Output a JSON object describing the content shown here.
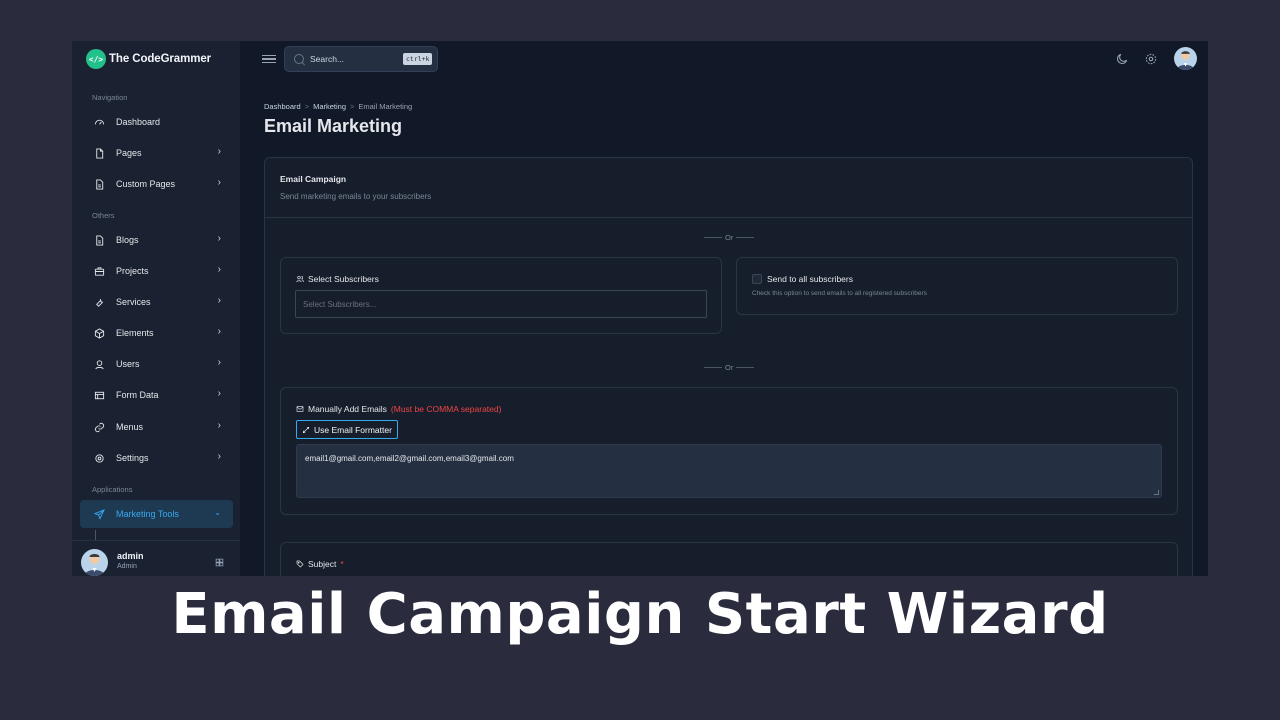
{
  "brand": {
    "logo_glyph": "</>",
    "name": "The CodeGrammer"
  },
  "sidebar": {
    "sections": [
      "Navigation",
      "Others",
      "Applications"
    ],
    "items": [
      {
        "label": "Dashboard",
        "icon": "dashboard-icon"
      },
      {
        "label": "Pages",
        "icon": "file-icon"
      },
      {
        "label": "Custom Pages",
        "icon": "file-text-icon"
      },
      {
        "label": "Blogs",
        "icon": "file-text-icon"
      },
      {
        "label": "Projects",
        "icon": "briefcase-icon"
      },
      {
        "label": "Services",
        "icon": "wrench-icon"
      },
      {
        "label": "Elements",
        "icon": "box-icon"
      },
      {
        "label": "Users",
        "icon": "user-icon"
      },
      {
        "label": "Form Data",
        "icon": "table-icon"
      },
      {
        "label": "Menus",
        "icon": "link-icon"
      },
      {
        "label": "Settings",
        "icon": "gear-icon"
      },
      {
        "label": "Marketing Tools",
        "icon": "send-icon",
        "active": true
      }
    ],
    "chevron": "›",
    "chevron_open": "⌄",
    "user": {
      "name": "admin",
      "role": "Admin"
    }
  },
  "topbar": {
    "search_placeholder": "Search...",
    "search_shortcut": "ctrl+k"
  },
  "breadcrumb": [
    "Dashboard",
    "Marketing",
    "Email Marketing"
  ],
  "breadcrumb_sep": ">",
  "page_title": "Email Marketing",
  "card": {
    "title": "Email Campaign",
    "subtitle": "Send marketing emails to your subscribers",
    "or_label": "Or",
    "select_subscribers": {
      "label": "Select Subscribers",
      "placeholder": "Select Subscribers..."
    },
    "send_all": {
      "label": "Send to all subscribers",
      "help": "Check this option to send emails to all registered subscribers",
      "checked": false
    },
    "manual": {
      "label": "Manually Add Emails",
      "warning": "(Must be COMMA separated)",
      "formatter_button": "Use Email Formatter",
      "value": "email1@gmail.com,email2@gmail.com,email3@gmail.com"
    },
    "subject": {
      "label": "Subject",
      "required_mark": "*"
    }
  },
  "caption": "Email Campaign Start Wizard",
  "colors": {
    "accent": "#38a8f0",
    "brand": "#22c08a",
    "warning": "#ef4444",
    "background": "#2a2b3d"
  }
}
